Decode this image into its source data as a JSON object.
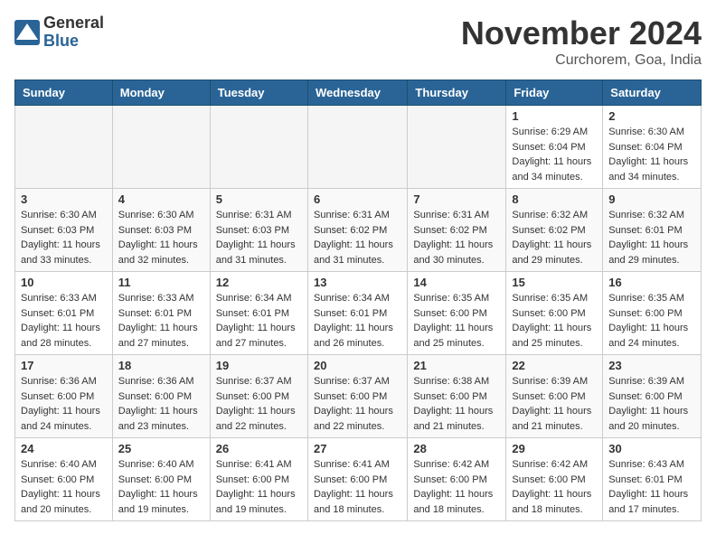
{
  "header": {
    "logo_general": "General",
    "logo_blue": "Blue",
    "month_title": "November 2024",
    "location": "Curchorem, Goa, India"
  },
  "days_of_week": [
    "Sunday",
    "Monday",
    "Tuesday",
    "Wednesday",
    "Thursday",
    "Friday",
    "Saturday"
  ],
  "weeks": [
    [
      {
        "day": "",
        "info": ""
      },
      {
        "day": "",
        "info": ""
      },
      {
        "day": "",
        "info": ""
      },
      {
        "day": "",
        "info": ""
      },
      {
        "day": "",
        "info": ""
      },
      {
        "day": "1",
        "info": "Sunrise: 6:29 AM\nSunset: 6:04 PM\nDaylight: 11 hours and 34 minutes."
      },
      {
        "day": "2",
        "info": "Sunrise: 6:30 AM\nSunset: 6:04 PM\nDaylight: 11 hours and 34 minutes."
      }
    ],
    [
      {
        "day": "3",
        "info": "Sunrise: 6:30 AM\nSunset: 6:03 PM\nDaylight: 11 hours and 33 minutes."
      },
      {
        "day": "4",
        "info": "Sunrise: 6:30 AM\nSunset: 6:03 PM\nDaylight: 11 hours and 32 minutes."
      },
      {
        "day": "5",
        "info": "Sunrise: 6:31 AM\nSunset: 6:03 PM\nDaylight: 11 hours and 31 minutes."
      },
      {
        "day": "6",
        "info": "Sunrise: 6:31 AM\nSunset: 6:02 PM\nDaylight: 11 hours and 31 minutes."
      },
      {
        "day": "7",
        "info": "Sunrise: 6:31 AM\nSunset: 6:02 PM\nDaylight: 11 hours and 30 minutes."
      },
      {
        "day": "8",
        "info": "Sunrise: 6:32 AM\nSunset: 6:02 PM\nDaylight: 11 hours and 29 minutes."
      },
      {
        "day": "9",
        "info": "Sunrise: 6:32 AM\nSunset: 6:01 PM\nDaylight: 11 hours and 29 minutes."
      }
    ],
    [
      {
        "day": "10",
        "info": "Sunrise: 6:33 AM\nSunset: 6:01 PM\nDaylight: 11 hours and 28 minutes."
      },
      {
        "day": "11",
        "info": "Sunrise: 6:33 AM\nSunset: 6:01 PM\nDaylight: 11 hours and 27 minutes."
      },
      {
        "day": "12",
        "info": "Sunrise: 6:34 AM\nSunset: 6:01 PM\nDaylight: 11 hours and 27 minutes."
      },
      {
        "day": "13",
        "info": "Sunrise: 6:34 AM\nSunset: 6:01 PM\nDaylight: 11 hours and 26 minutes."
      },
      {
        "day": "14",
        "info": "Sunrise: 6:35 AM\nSunset: 6:00 PM\nDaylight: 11 hours and 25 minutes."
      },
      {
        "day": "15",
        "info": "Sunrise: 6:35 AM\nSunset: 6:00 PM\nDaylight: 11 hours and 25 minutes."
      },
      {
        "day": "16",
        "info": "Sunrise: 6:35 AM\nSunset: 6:00 PM\nDaylight: 11 hours and 24 minutes."
      }
    ],
    [
      {
        "day": "17",
        "info": "Sunrise: 6:36 AM\nSunset: 6:00 PM\nDaylight: 11 hours and 24 minutes."
      },
      {
        "day": "18",
        "info": "Sunrise: 6:36 AM\nSunset: 6:00 PM\nDaylight: 11 hours and 23 minutes."
      },
      {
        "day": "19",
        "info": "Sunrise: 6:37 AM\nSunset: 6:00 PM\nDaylight: 11 hours and 22 minutes."
      },
      {
        "day": "20",
        "info": "Sunrise: 6:37 AM\nSunset: 6:00 PM\nDaylight: 11 hours and 22 minutes."
      },
      {
        "day": "21",
        "info": "Sunrise: 6:38 AM\nSunset: 6:00 PM\nDaylight: 11 hours and 21 minutes."
      },
      {
        "day": "22",
        "info": "Sunrise: 6:39 AM\nSunset: 6:00 PM\nDaylight: 11 hours and 21 minutes."
      },
      {
        "day": "23",
        "info": "Sunrise: 6:39 AM\nSunset: 6:00 PM\nDaylight: 11 hours and 20 minutes."
      }
    ],
    [
      {
        "day": "24",
        "info": "Sunrise: 6:40 AM\nSunset: 6:00 PM\nDaylight: 11 hours and 20 minutes."
      },
      {
        "day": "25",
        "info": "Sunrise: 6:40 AM\nSunset: 6:00 PM\nDaylight: 11 hours and 19 minutes."
      },
      {
        "day": "26",
        "info": "Sunrise: 6:41 AM\nSunset: 6:00 PM\nDaylight: 11 hours and 19 minutes."
      },
      {
        "day": "27",
        "info": "Sunrise: 6:41 AM\nSunset: 6:00 PM\nDaylight: 11 hours and 18 minutes."
      },
      {
        "day": "28",
        "info": "Sunrise: 6:42 AM\nSunset: 6:00 PM\nDaylight: 11 hours and 18 minutes."
      },
      {
        "day": "29",
        "info": "Sunrise: 6:42 AM\nSunset: 6:00 PM\nDaylight: 11 hours and 18 minutes."
      },
      {
        "day": "30",
        "info": "Sunrise: 6:43 AM\nSunset: 6:01 PM\nDaylight: 11 hours and 17 minutes."
      }
    ]
  ]
}
